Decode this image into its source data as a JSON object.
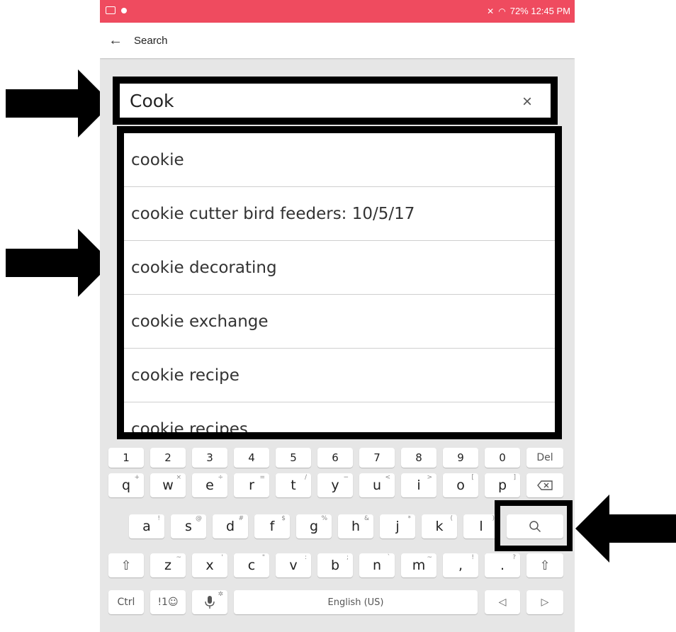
{
  "status_bar": {
    "right_text": "72%  12:45 PM",
    "wifi_icon": "wifi-icon",
    "battery_icon": "battery-icon"
  },
  "app_bar": {
    "back_icon": "←",
    "title": "Search"
  },
  "search": {
    "value": "Cook",
    "clear_icon": "×"
  },
  "suggestions": [
    "cookie",
    "cookie cutter bird feeders: 10/5/17",
    "cookie decorating",
    "cookie exchange",
    "cookie recipe",
    "cookie recipes"
  ],
  "keyboard": {
    "numbers": [
      "1",
      "2",
      "3",
      "4",
      "5",
      "6",
      "7",
      "8",
      "9",
      "0"
    ],
    "del": "Del",
    "row1": [
      [
        "q",
        "+"
      ],
      [
        "w",
        "×"
      ],
      [
        "e",
        "÷"
      ],
      [
        "r",
        "="
      ],
      [
        "t",
        "/"
      ],
      [
        "y",
        "−"
      ],
      [
        "u",
        "<"
      ],
      [
        "i",
        ">"
      ],
      [
        "o",
        "["
      ],
      [
        "p",
        "]"
      ]
    ],
    "row2": [
      [
        "a",
        "!"
      ],
      [
        "s",
        "@"
      ],
      [
        "d",
        "#"
      ],
      [
        "f",
        "$"
      ],
      [
        "g",
        "%"
      ],
      [
        "h",
        "&"
      ],
      [
        "j",
        "*"
      ],
      [
        "k",
        "("
      ],
      [
        "l",
        ")"
      ]
    ],
    "row3": [
      [
        "z",
        "~"
      ],
      [
        "x",
        "'"
      ],
      [
        "c",
        "\""
      ],
      [
        "v",
        ":"
      ],
      [
        "b",
        ";"
      ],
      [
        "n",
        "`"
      ],
      [
        "m",
        "~"
      ],
      [
        ",",
        "!"
      ],
      [
        ".",
        "?"
      ]
    ],
    "ctrl": "Ctrl",
    "symbols": "!1☺",
    "space": "English (US)"
  }
}
